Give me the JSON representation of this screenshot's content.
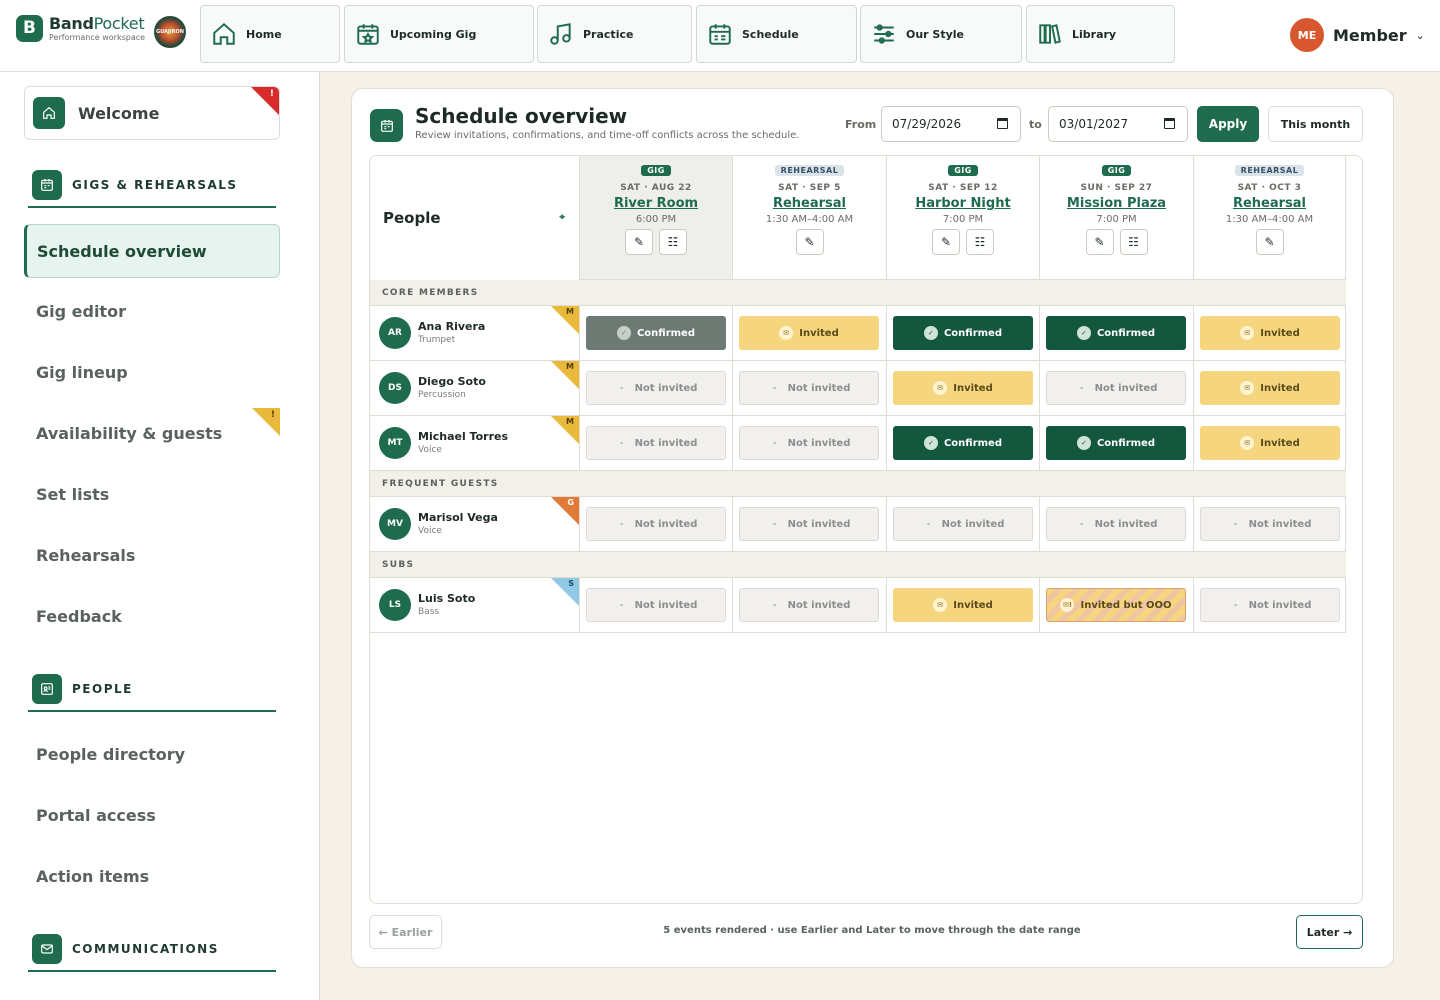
{
  "brand": {
    "name_a": "Band",
    "name_b": "Pocket",
    "subtitle": "Performance workspace",
    "logo_badge": "GUAJIRON"
  },
  "nav": [
    {
      "label": "Home",
      "icon": "home-icon"
    },
    {
      "label": "Upcoming Gig",
      "icon": "calendar-star-icon"
    },
    {
      "label": "Practice",
      "icon": "music-note-icon"
    },
    {
      "label": "Schedule",
      "icon": "schedule-icon"
    },
    {
      "label": "Our Style",
      "icon": "sliders-icon"
    },
    {
      "label": "Library",
      "icon": "library-icon"
    }
  ],
  "user": {
    "initials": "ME",
    "name": "Member"
  },
  "sidebar": {
    "welcome": {
      "label": "Welcome",
      "alert": "!"
    },
    "sections": [
      {
        "label": "GIGS & REHEARSALS",
        "icon": "calendar-icon"
      },
      {
        "label": "PEOPLE",
        "icon": "contact-card-icon"
      },
      {
        "label": "COMMUNICATIONS",
        "icon": "mail-icon"
      }
    ],
    "gig_items": [
      {
        "label": "Schedule overview",
        "active": true
      },
      {
        "label": "Gig editor"
      },
      {
        "label": "Gig lineup"
      },
      {
        "label": "Availability & guests",
        "alert": "!"
      },
      {
        "label": "Set lists"
      },
      {
        "label": "Rehearsals"
      },
      {
        "label": "Feedback"
      }
    ],
    "people_items": [
      {
        "label": "People directory"
      },
      {
        "label": "Portal access"
      },
      {
        "label": "Action items"
      }
    ]
  },
  "main": {
    "title": "Schedule overview",
    "subtitle": "Review invitations, confirmations, and time-off conflicts across the schedule.",
    "from_label": "From",
    "from_value": "07/29/2026",
    "to_label": "to",
    "to_value": "03/01/2027",
    "apply_label": "Apply",
    "this_month_label": "This month",
    "people_header": "People",
    "events": [
      {
        "tag": "GIG",
        "date": "SAT · AUG 22",
        "name": "River Room",
        "time": "6:00 PM"
      },
      {
        "tag": "REHEARSAL",
        "date": "SAT · SEP 5",
        "name": "Rehearsal",
        "time": "1:30 AM–4:00 AM"
      },
      {
        "tag": "GIG",
        "date": "SAT · SEP 12",
        "name": "Harbor Night",
        "time": "7:00 PM"
      },
      {
        "tag": "GIG",
        "date": "SUN · SEP 27",
        "name": "Mission Plaza",
        "time": "7:00 PM"
      },
      {
        "tag": "REHEARSAL",
        "date": "SAT · OCT 3",
        "name": "Rehearsal",
        "time": "1:30 AM–4:00 AM"
      }
    ],
    "groups": [
      {
        "label": "CORE MEMBERS",
        "people": [
          {
            "initials": "AR",
            "name": "Ana Rivera",
            "role": "Trumpet",
            "badge": "M",
            "statuses": [
              "Confirmed",
              "Invited",
              "Confirmed",
              "Confirmed",
              "Invited"
            ]
          },
          {
            "initials": "DS",
            "name": "Diego Soto",
            "role": "Percussion",
            "badge": "M",
            "statuses": [
              "Not invited",
              "Not invited",
              "Invited",
              "Not invited",
              "Invited"
            ]
          },
          {
            "initials": "MT",
            "name": "Michael Torres",
            "role": "Voice",
            "badge": "M",
            "statuses": [
              "Not invited",
              "Not invited",
              "Confirmed",
              "Confirmed",
              "Invited"
            ]
          }
        ]
      },
      {
        "label": "FREQUENT GUESTS",
        "people": [
          {
            "initials": "MV",
            "name": "Marisol Vega",
            "role": "Voice",
            "badge": "G",
            "statuses": [
              "Not invited",
              "Not invited",
              "Not invited",
              "Not invited",
              "Not invited"
            ]
          }
        ]
      },
      {
        "label": "SUBS",
        "people": [
          {
            "initials": "LS",
            "name": "Luis Soto",
            "role": "Bass",
            "badge": "S",
            "statuses": [
              "Not invited",
              "Not invited",
              "Invited",
              "Invited but OOO",
              "Not invited"
            ]
          }
        ]
      }
    ],
    "earlier_label": "← Earlier",
    "later_label": "Later →",
    "footer_text": "5 events rendered · use Earlier and Later to move through the date range"
  },
  "colors": {
    "accent": "#1f6b4e",
    "confirmed": "#14573f",
    "invited": "#f5d67f",
    "alert": "#d92b2b",
    "warning": "#e8b93a",
    "guest": "#e07a3a",
    "sub": "#8fc9e6"
  }
}
